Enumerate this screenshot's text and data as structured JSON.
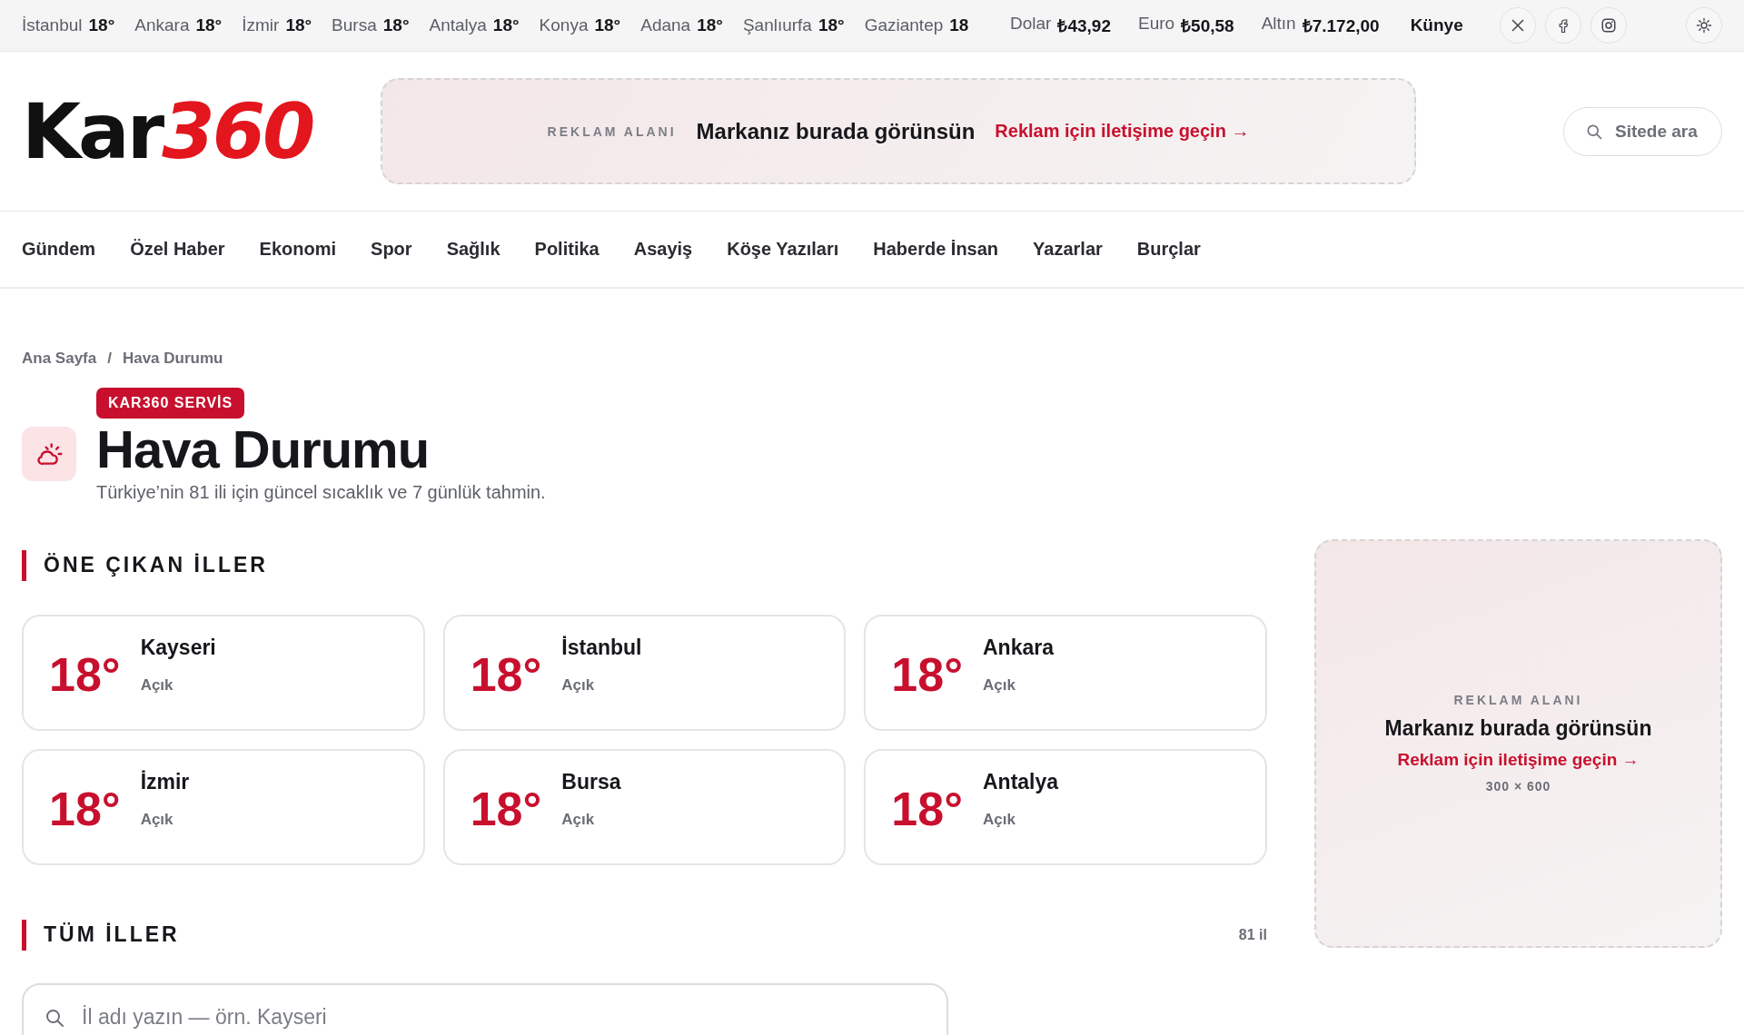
{
  "ticker": {
    "cities": [
      {
        "name": "İstanbul",
        "temp": "18°"
      },
      {
        "name": "Ankara",
        "temp": "18°"
      },
      {
        "name": "İzmir",
        "temp": "18°"
      },
      {
        "name": "Bursa",
        "temp": "18°"
      },
      {
        "name": "Antalya",
        "temp": "18°"
      },
      {
        "name": "Konya",
        "temp": "18°"
      },
      {
        "name": "Adana",
        "temp": "18°"
      },
      {
        "name": "Şanlıurfa",
        "temp": "18°"
      },
      {
        "name": "Gaziantep",
        "temp": "18"
      }
    ],
    "markets": [
      {
        "name": "Dolar",
        "value": "₺43,92"
      },
      {
        "name": "Euro",
        "value": "₺50,58"
      },
      {
        "name": "Altın",
        "value": "₺7.172,00"
      }
    ],
    "link": "Künye"
  },
  "header": {
    "logo": {
      "black": "Kar",
      "red": "360"
    },
    "ad": {
      "label": "REKLAM ALANI",
      "headline": "Markanız burada görünsün",
      "cta": "Reklam için iletişime geçin →"
    },
    "search": {
      "placeholder": "Sitede ara"
    }
  },
  "nav": [
    "Gündem",
    "Özel Haber",
    "Ekonomi",
    "Spor",
    "Sağlık",
    "Politika",
    "Asayiş",
    "Köşe Yazıları",
    "Haberde İnsan",
    "Yazarlar",
    "Burçlar"
  ],
  "breadcrumb": {
    "items": [
      "Ana Sayfa",
      "Hava Durumu"
    ],
    "separator": "/"
  },
  "page": {
    "badge": "KAR360 SERVİS",
    "title": "Hava Durumu",
    "subtitle": "Türkiye’nin 81 ili için güncel sıcaklık ve 7 günlük tahmin."
  },
  "featured": {
    "heading": "ÖNE ÇIKAN İLLER",
    "cities": [
      {
        "temp": "18°",
        "name": "Kayseri",
        "condition": "Açık"
      },
      {
        "temp": "18°",
        "name": "İstanbul",
        "condition": "Açık"
      },
      {
        "temp": "18°",
        "name": "Ankara",
        "condition": "Açık"
      },
      {
        "temp": "18°",
        "name": "İzmir",
        "condition": "Açık"
      },
      {
        "temp": "18°",
        "name": "Bursa",
        "condition": "Açık"
      },
      {
        "temp": "18°",
        "name": "Antalya",
        "condition": "Açık"
      }
    ]
  },
  "all": {
    "heading": "TÜM İLLER",
    "count": "81 il",
    "search": {
      "placeholder": "İl adı yazın — örn. Kayseri"
    }
  },
  "side_ad": {
    "label": "REKLAM ALANI",
    "headline": "Markanız burada görünsün",
    "cta": "Reklam için iletişime geçin →",
    "size": "300 × 600"
  }
}
